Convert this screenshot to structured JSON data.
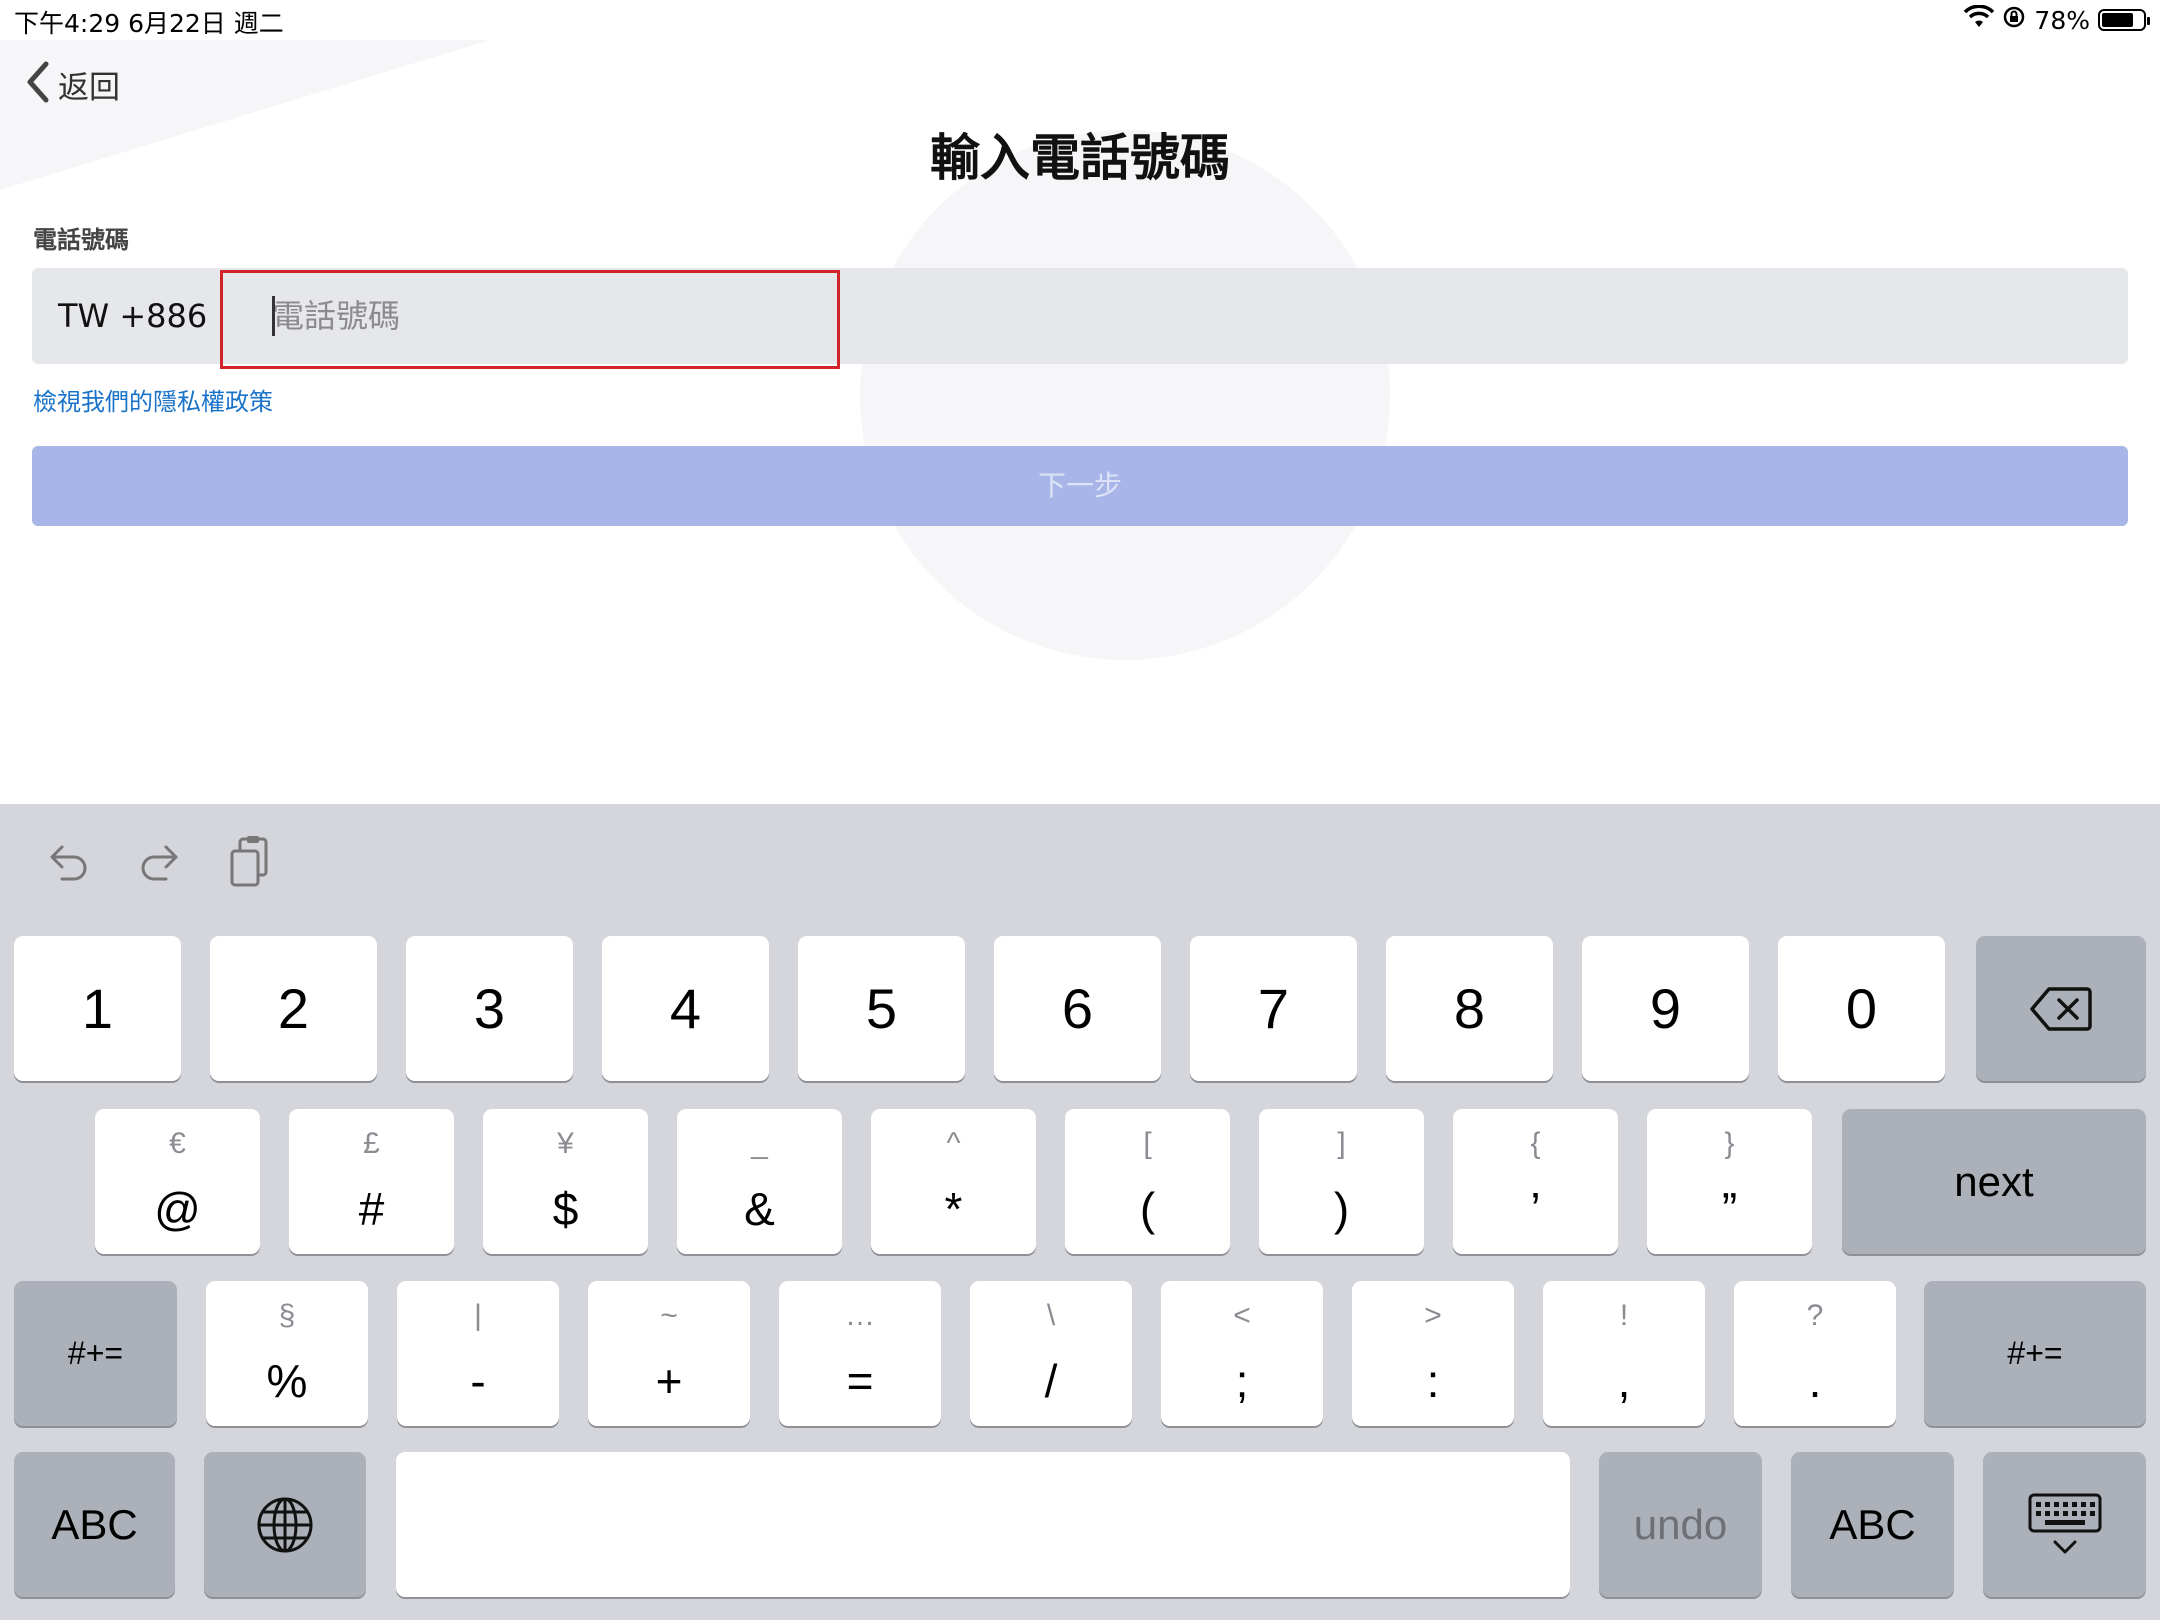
{
  "status_bar": {
    "time_date": "下午4:29   6月22日 週二",
    "battery_text": "78%",
    "battery_level": 0.78
  },
  "header": {
    "back_label": "返回",
    "title": "輸入電話號碼"
  },
  "form": {
    "field_label": "電話號碼",
    "country_code": "TW +886",
    "phone_placeholder": "電話號碼",
    "phone_value": "",
    "privacy_link": "檢視我們的隱私權政策",
    "next_button": "下一步"
  },
  "keyboard": {
    "row1": [
      {
        "label": "1"
      },
      {
        "label": "2"
      },
      {
        "label": "3"
      },
      {
        "label": "4"
      },
      {
        "label": "5"
      },
      {
        "label": "6"
      },
      {
        "label": "7"
      },
      {
        "label": "8"
      },
      {
        "label": "9"
      },
      {
        "label": "0"
      }
    ],
    "row2": [
      {
        "top": "€",
        "bottom": "@"
      },
      {
        "top": "£",
        "bottom": "#"
      },
      {
        "top": "¥",
        "bottom": "$"
      },
      {
        "top": "_",
        "bottom": "&"
      },
      {
        "top": "^",
        "bottom": "*"
      },
      {
        "top": "[",
        "bottom": "("
      },
      {
        "top": "]",
        "bottom": ")"
      },
      {
        "top": "{",
        "bottom": "’"
      },
      {
        "top": "}",
        "bottom": "”"
      }
    ],
    "next_label": "next",
    "row3": [
      {
        "top": "§",
        "bottom": "%"
      },
      {
        "top": "|",
        "bottom": "-"
      },
      {
        "top": "~",
        "bottom": "+"
      },
      {
        "top": "…",
        "bottom": "="
      },
      {
        "top": "\\",
        "bottom": "/"
      },
      {
        "top": "<",
        "bottom": ";"
      },
      {
        "top": ">",
        "bottom": ":"
      },
      {
        "top": "!",
        "bottom": ","
      },
      {
        "top": "?",
        "bottom": "."
      }
    ],
    "shift_label": "#+=",
    "abc_label": "ABC",
    "undo_label": "undo"
  }
}
